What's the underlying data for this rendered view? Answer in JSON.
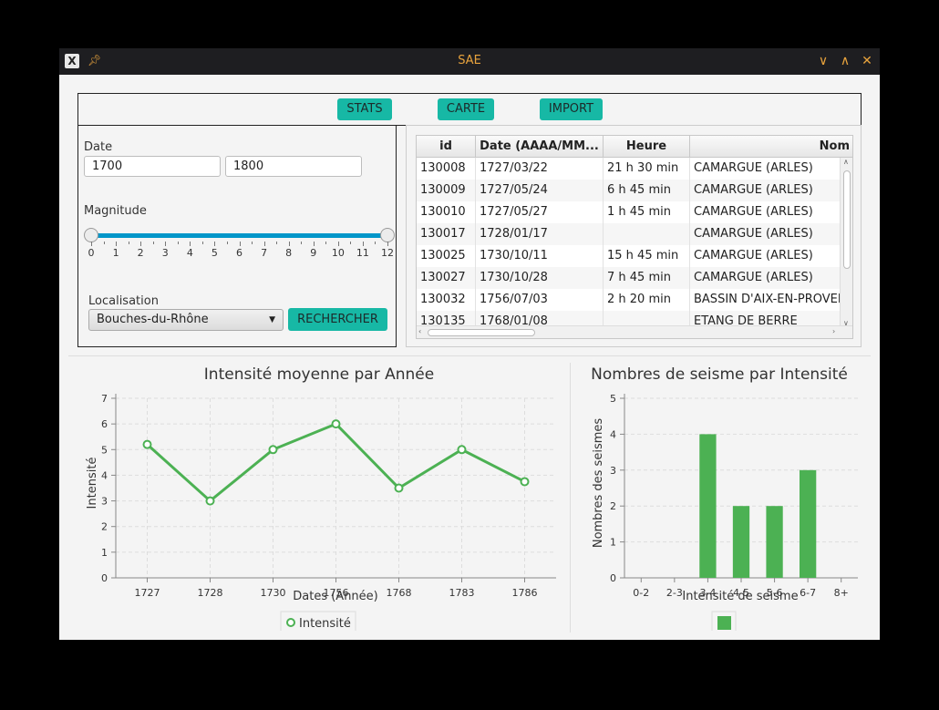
{
  "window": {
    "title": "SAE"
  },
  "toolbar": {
    "stats": "STATS",
    "carte": "CARTE",
    "import": "IMPORT"
  },
  "filters": {
    "date_label": "Date",
    "date_from": "1700",
    "date_to": "1800",
    "magnitude_label": "Magnitude",
    "magnitude_min": 0,
    "magnitude_max": 12,
    "magnitude_ticks": [
      "0",
      "1",
      "2",
      "3",
      "4",
      "5",
      "6",
      "7",
      "8",
      "9",
      "10",
      "11",
      "12"
    ],
    "localisation_label": "Localisation",
    "localisation_value": "Bouches-du-Rhône",
    "search_button": "RECHERCHER"
  },
  "table": {
    "columns": [
      "id",
      "Date (AAAA/MM...",
      "Heure",
      "Nom"
    ],
    "rows": [
      [
        "130008",
        "1727/03/22",
        "21 h 30 min",
        "CAMARGUE (ARLES)"
      ],
      [
        "130009",
        "1727/05/24",
        "6 h 45 min",
        "CAMARGUE (ARLES)"
      ],
      [
        "130010",
        "1727/05/27",
        "1 h 45 min",
        "CAMARGUE (ARLES)"
      ],
      [
        "130017",
        "1728/01/17",
        "",
        "CAMARGUE (ARLES)"
      ],
      [
        "130025",
        "1730/10/11",
        "15 h 45 min",
        "CAMARGUE (ARLES)"
      ],
      [
        "130027",
        "1730/10/28",
        "7 h 45 min",
        "CAMARGUE (ARLES)"
      ],
      [
        "130032",
        "1756/07/03",
        "2 h 20 min",
        "BASSIN D'AIX-EN-PROVEN"
      ],
      [
        "130135",
        "1768/01/08",
        "",
        "ETANG DE BERRE"
      ]
    ]
  },
  "colors": {
    "teal": "#17b8a5",
    "green": "#4cb153",
    "slider": "#0096c9"
  },
  "chart_data": [
    {
      "type": "line",
      "title": "Intensité moyenne par Année",
      "xlabel": "Dates (Année)",
      "ylabel": "Intensité",
      "categories": [
        "1727",
        "1728",
        "1730",
        "1756",
        "1768",
        "1783",
        "1786"
      ],
      "series": [
        {
          "name": "Intensité",
          "values": [
            5.2,
            3.0,
            5.0,
            6.0,
            3.5,
            5.0,
            3.75
          ]
        }
      ],
      "ylim": [
        0,
        7
      ],
      "yticks": [
        0,
        1,
        2,
        3,
        4,
        5,
        6,
        7
      ],
      "grid": true,
      "legend": "bottom"
    },
    {
      "type": "bar",
      "title": "Nombres de seisme par Intensité",
      "xlabel": "Intensité de seisme",
      "ylabel": "Nombres des seismes",
      "categories": [
        "0-2",
        "2-3",
        "3-4",
        "4-5",
        "5-6",
        "6-7",
        "8+"
      ],
      "values": [
        0,
        0,
        4,
        2,
        2,
        3,
        0
      ],
      "ylim": [
        0,
        5
      ],
      "yticks": [
        0,
        1,
        2,
        3,
        4,
        5
      ],
      "grid": true,
      "legend": "bottom"
    }
  ]
}
